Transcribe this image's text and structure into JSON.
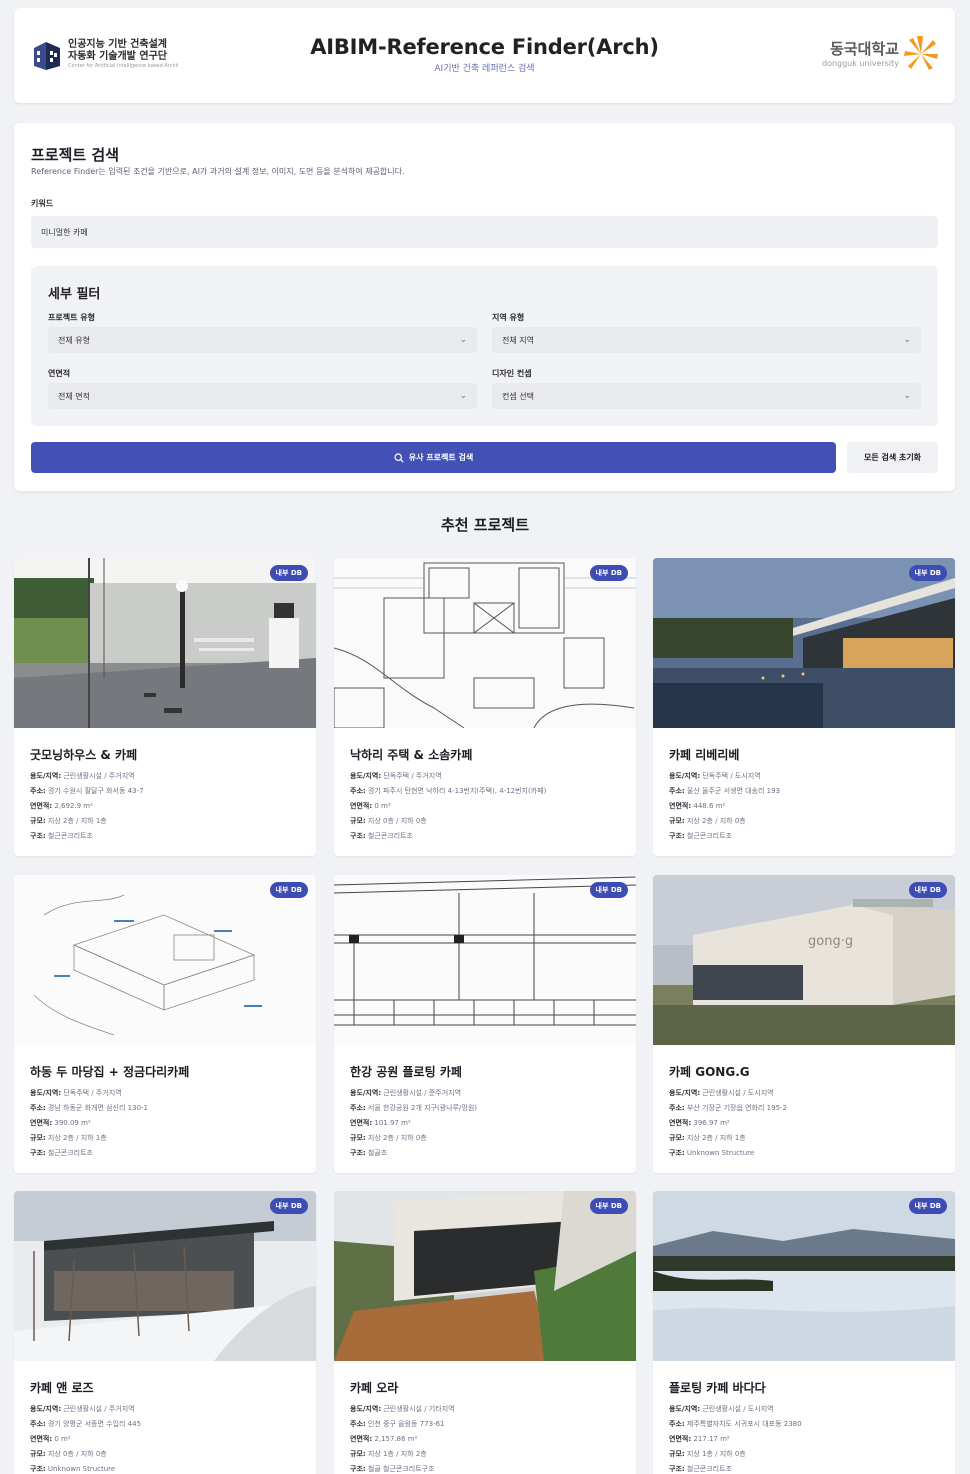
{
  "header": {
    "lab_line1": "인공지능 기반 건축설계",
    "lab_line2": "자동화 기술개발 연구단",
    "lab_sub": "Center for Artificial Intelligence based Architectural Design Automation Technologies",
    "app_title": "AIBIM-Reference Finder(Arch)",
    "app_subtitle": "AI기반 건축 레퍼런스 검색",
    "uni_kr": "동국대학교",
    "uni_en": "dongguk university"
  },
  "search": {
    "title": "프로젝트 검색",
    "description": "Reference Finder는 입력된 조건을 기반으로, AI가 과거의 설계 정보, 이미지, 도면 등을 분석하여 제공합니다.",
    "keyword_label": "키워드",
    "keyword_value": "미니멀한 카페",
    "filters_title": "세부 필터",
    "filters": [
      {
        "label": "프로젝트 유형",
        "value": "전체 유형"
      },
      {
        "label": "지역 유형",
        "value": "전체 지역"
      },
      {
        "label": "연면적",
        "value": "전체 면적"
      },
      {
        "label": "디자인 컨셉",
        "value": "컨셉 선택"
      }
    ],
    "search_button": "유사 프로젝트 검색",
    "reset_button": "모든 검색 초기화"
  },
  "results": {
    "section_title": "추천 프로젝트",
    "badge": "내부 DB",
    "labels": {
      "use": "용도/지역:",
      "addr": "주소:",
      "area": "연면적:",
      "scale": "규모:",
      "structure": "구조:"
    },
    "cards": [
      {
        "title": "굿모닝하우스 & 카페",
        "use": "근린생활시설 / 주거지역",
        "addr": "경기 수원시 팔달구 화서동 43-7",
        "area": "2,692.9 m²",
        "scale": "지상 2층 / 지하 1층",
        "structure": "철근콘크리트조"
      },
      {
        "title": "낙하리 주택 & 소솜카페",
        "use": "단독주택 / 주거지역",
        "addr": "경기 파주시 탄현면 낙하리 4-13번지(주택), 4-12번지(카페)",
        "area": "0 m²",
        "scale": "지상 0층 / 지하 0층",
        "structure": "철근콘크리트조"
      },
      {
        "title": "카페 리베리베",
        "use": "단독주택 / 도시지역",
        "addr": "울산 울주군 서생면 대송리 193",
        "area": "448.6 m²",
        "scale": "지상 2층 / 지하 0층",
        "structure": "철근콘크리트조"
      },
      {
        "title": "하동 두 마당집 + 정금다리카페",
        "use": "단독주택 / 주거지역",
        "addr": "경남 하동군 화개면 삼신리 130-1",
        "area": "390.09 m²",
        "scale": "지상 2층 / 지하 1층",
        "structure": "철근콘크리트조"
      },
      {
        "title": "한강 공원 플로팅 카페",
        "use": "근린생활시설 / 준주거지역",
        "addr": "서울 한강공원 2개 지구(광나루/망원)",
        "area": "101.97 m²",
        "scale": "지상 2층 / 지하 0층",
        "structure": "철골조"
      },
      {
        "title": "카페 GONG.G",
        "use": "근린생활시설 / 도시지역",
        "addr": "부산 기장군 기장읍 연화리 195-2",
        "area": "396.97 m²",
        "scale": "지상 2층 / 지하 1층",
        "structure": "Unknown Structure"
      },
      {
        "title": "카페 앤 로즈",
        "use": "근린생활시설 / 주거지역",
        "addr": "경기 양평군 서종면 수입리 445",
        "area": "0 m²",
        "scale": "지상 0층 / 지하 0층",
        "structure": "Unknown Structure"
      },
      {
        "title": "카페 오라",
        "use": "근린생활시설 / 기타지역",
        "addr": "인천 중구 을왕동 773-61",
        "area": "2,157.86 m²",
        "scale": "지상 1층 / 지하 2층",
        "structure": "철골 철근콘크리트구조"
      },
      {
        "title": "플로팅 카페 바다다",
        "use": "근린생활시설 / 도시지역",
        "addr": "제주특별자치도 서귀포시 대포동 2380",
        "area": "217.17 m²",
        "scale": "지상 1층 / 지하 0층",
        "structure": "철근콘크리트조"
      }
    ]
  }
}
